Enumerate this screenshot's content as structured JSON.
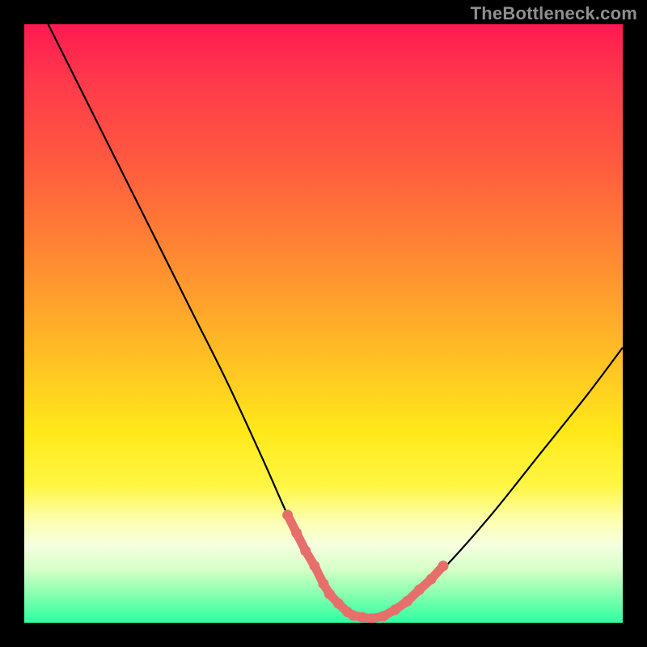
{
  "watermark": "TheBottleneck.com",
  "colors": {
    "frame": "#000000",
    "curve": "#000000",
    "marker_fill": "#e76f6b",
    "marker_stroke": "#c95a57",
    "gradient_stops": [
      "#ff1a52",
      "#ff3b4b",
      "#ff5740",
      "#ff7a36",
      "#ffa02c",
      "#ffc722",
      "#ffe81a",
      "#fff642",
      "#fcffb0",
      "#f6ffe0",
      "#d6ffc8",
      "#8cffb0",
      "#2cffa2"
    ]
  },
  "chart_data": {
    "type": "line",
    "title": "",
    "xlabel": "",
    "ylabel": "",
    "xlim": [
      0,
      100
    ],
    "ylim": [
      0,
      100
    ],
    "curve": {
      "x": [
        4,
        10,
        16,
        22,
        28,
        34,
        40,
        44,
        48,
        50,
        52,
        54,
        56,
        58,
        60,
        64,
        70,
        78,
        86,
        94,
        100
      ],
      "y": [
        100,
        88,
        76,
        64,
        52,
        40,
        27,
        18,
        10,
        6,
        3,
        1.5,
        0.8,
        0.6,
        1.2,
        3.5,
        9,
        18,
        28,
        38,
        46
      ]
    },
    "series": [
      {
        "name": "highlight-markers",
        "x": [
          44,
          45.5,
          47,
          48.5,
          50,
          51,
          52.5,
          54,
          55,
          56.5,
          58,
          60,
          62,
          64,
          66,
          68,
          70
        ],
        "y": [
          18,
          15,
          12,
          9.5,
          6.5,
          4.8,
          3.2,
          1.8,
          1.2,
          0.9,
          0.7,
          1.1,
          2.2,
          3.6,
          5.5,
          7.3,
          9.5
        ]
      }
    ]
  }
}
